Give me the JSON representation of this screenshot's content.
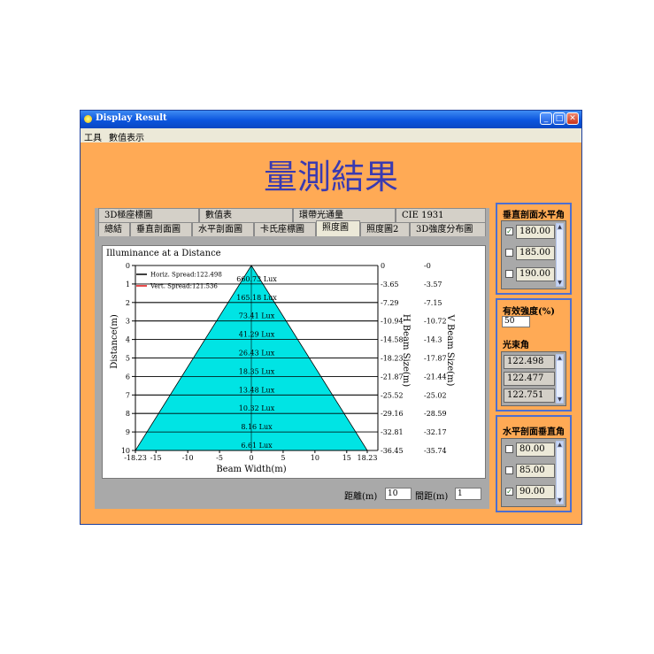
{
  "window": {
    "title": "Display Result"
  },
  "menu": {
    "items": [
      "工具",
      "數值表示"
    ]
  },
  "main_title": "量測結果",
  "tabs_row1": [
    "3D極座標圖",
    "數值表",
    "環帶光通量",
    "CIE 1931"
  ],
  "tabs_row2": [
    "總結",
    "垂直剖面圖",
    "水平剖面圖",
    "卡氏座標圖",
    "照度圖",
    "照度圖2",
    "3D強度分布圖"
  ],
  "active_tab": "照度圖",
  "colors": {
    "accent": "#ffaa55",
    "cone": "#00e4e4",
    "title": "#3a3ab0",
    "horiz_line": "#000000",
    "vert_line": "#e01010"
  },
  "chart_data": {
    "type": "area",
    "title": "Illuminance at a Distance",
    "xlabel": "Beam Width(m)",
    "ylabel": "Distance(m)",
    "right_label_1": "H Beam Size(m)",
    "right_label_2": "V Beam Size(m)",
    "xlim": [
      -18.23,
      18.23
    ],
    "ylim": [
      0,
      10
    ],
    "x_ticks": [
      "-18.23",
      "-15",
      "-10",
      "-5",
      "0",
      "5",
      "10",
      "15",
      "18.23"
    ],
    "x_tick_values": [
      -18.23,
      -15,
      -10,
      -5,
      0,
      5,
      10,
      15,
      18.23
    ],
    "y_ticks": [
      "0",
      "1",
      "2",
      "3",
      "4",
      "5",
      "6",
      "7",
      "8",
      "9",
      "10"
    ],
    "h_beam_size": [
      "0",
      "-3.65",
      "-7.29",
      "-10.94",
      "-14.58",
      "-18.23",
      "-21.87",
      "-25.52",
      "-29.16",
      "-32.81",
      "-36.45"
    ],
    "v_beam_size": [
      "-0",
      "-3.57",
      "-7.15",
      "-10.72",
      "-14.3",
      "-17.87",
      "-21.44",
      "-25.02",
      "-28.59",
      "-32.17",
      "-35.74"
    ],
    "lux_labels": [
      {
        "distance": 1,
        "label": "660.73 Lux"
      },
      {
        "distance": 2,
        "label": "165.18 Lux"
      },
      {
        "distance": 3,
        "label": "73.41 Lux"
      },
      {
        "distance": 4,
        "label": "41.29 Lux"
      },
      {
        "distance": 5,
        "label": "26.43 Lux"
      },
      {
        "distance": 6,
        "label": "18.35 Lux"
      },
      {
        "distance": 7,
        "label": "13.48 Lux"
      },
      {
        "distance": 8,
        "label": "10.32 Lux"
      },
      {
        "distance": 9,
        "label": "8.16 Lux"
      },
      {
        "distance": 10,
        "label": "6.61 Lux"
      }
    ],
    "legend": [
      "Horiz. Spread:122.498",
      "Vert. Spread:121.536"
    ],
    "cone_half_width_at_max": 18.23
  },
  "bottom": {
    "distance_label": "距離(m)",
    "distance_value": "10",
    "interval_label": "間距(m)",
    "interval_value": "1"
  },
  "vertical_profile": {
    "title": "垂直剖面水平角",
    "items": [
      {
        "checked": true,
        "value": "180.00"
      },
      {
        "checked": false,
        "value": "185.00"
      },
      {
        "checked": false,
        "value": "190.00"
      }
    ]
  },
  "effective": {
    "intensity_label": "有效強度(%)",
    "intensity_value": "50",
    "beam_angle_label": "光束角",
    "beam_angles": [
      "122.498",
      "122.477",
      "122.751"
    ]
  },
  "horizontal_profile": {
    "title": "水平剖面垂直角",
    "items": [
      {
        "checked": false,
        "value": "80.00"
      },
      {
        "checked": false,
        "value": "85.00"
      },
      {
        "checked": true,
        "value": "90.00"
      }
    ]
  }
}
